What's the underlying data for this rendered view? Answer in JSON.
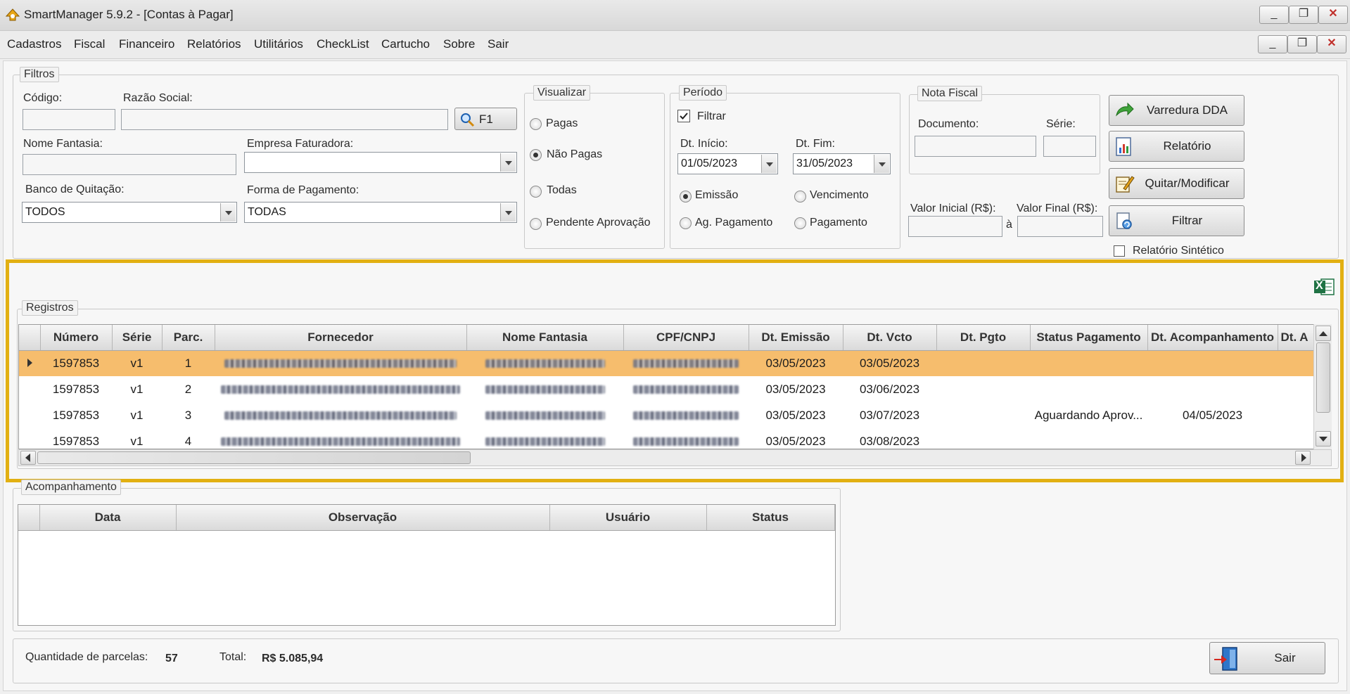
{
  "window": {
    "title": "SmartManager 5.9.2 - [Contas à Pagar]",
    "min_symbol": "_",
    "max_symbol": "❐",
    "close_symbol": "✕"
  },
  "menu": [
    "Cadastros",
    "Fiscal",
    "Financeiro",
    "Relatórios",
    "Utilitários",
    "CheckList",
    "Cartucho",
    "Sobre",
    "Sair"
  ],
  "filtros": {
    "legend": "Filtros",
    "codigo_label": "Código:",
    "codigo_value": "",
    "razao_label": "Razão Social:",
    "razao_value": "",
    "f1_label": "F1",
    "nome_fantasia_label": "Nome Fantasia:",
    "nome_fantasia_value": "",
    "empresa_label": "Empresa Faturadora:",
    "empresa_value": "",
    "banco_label": "Banco de Quitação:",
    "banco_value": "TODOS",
    "forma_label": "Forma de Pagamento:",
    "forma_value": "TODAS"
  },
  "visualizar": {
    "legend": "Visualizar",
    "options": [
      "Pagas",
      "Não Pagas",
      "Todas",
      "Pendente Aprovação"
    ],
    "selected": "Não Pagas"
  },
  "periodo": {
    "legend": "Período",
    "filtrar_label": "Filtrar",
    "filtrar_checked": true,
    "inicio_label": "Dt. Início:",
    "inicio_value": "01/05/2023",
    "fim_label": "Dt. Fim:",
    "fim_value": "31/05/2023",
    "options": [
      "Emissão",
      "Vencimento",
      "Ag. Pagamento",
      "Pagamento"
    ],
    "selected": "Emissão"
  },
  "nota_fiscal": {
    "legend": "Nota Fiscal",
    "documento_label": "Documento:",
    "serie_label": "Série:",
    "documento_value": "",
    "serie_value": ""
  },
  "valores": {
    "inicial_label": "Valor Inicial (R$):",
    "final_label": "Valor Final (R$):",
    "separator": "à",
    "inicial_value": "",
    "final_value": ""
  },
  "actions": {
    "varredura": "Varredura DDA",
    "relatorio": "Relatório",
    "quitar": "Quitar/Modificar",
    "filtrar": "Filtrar",
    "sintetico_label": "Relatório Sintético",
    "sintetico_checked": false
  },
  "registros": {
    "legend": "Registros",
    "excel_glyph": "X",
    "columns": [
      "Número",
      "Série",
      "Parc.",
      "Fornecedor",
      "Nome Fantasia",
      "CPF/CNPJ",
      "Dt. Emissão",
      "Dt. Vcto",
      "Dt. Pgto",
      "Status Pagamento",
      "Dt. Acompanhamento",
      "Dt. A"
    ],
    "rows": [
      {
        "numero": "1597853",
        "serie": "v1",
        "parc": "1",
        "emissao": "03/05/2023",
        "vcto": "03/05/2023",
        "pgto": "",
        "status": "",
        "acomp": "",
        "selected": true
      },
      {
        "numero": "1597853",
        "serie": "v1",
        "parc": "2",
        "emissao": "03/05/2023",
        "vcto": "03/06/2023",
        "pgto": "",
        "status": "",
        "acomp": "",
        "selected": false
      },
      {
        "numero": "1597853",
        "serie": "v1",
        "parc": "3",
        "emissao": "03/05/2023",
        "vcto": "03/07/2023",
        "pgto": "",
        "status": "Aguardando  Aprov...",
        "acomp": "04/05/2023",
        "selected": false
      },
      {
        "numero": "1597853",
        "serie": "v1",
        "parc": "4",
        "emissao": "03/05/2023",
        "vcto": "03/08/2023",
        "pgto": "",
        "status": "",
        "acomp": "",
        "selected": false
      }
    ]
  },
  "acompanhamento": {
    "legend": "Acompanhamento",
    "columns": [
      "Data",
      "Observação",
      "Usuário",
      "Status"
    ]
  },
  "footer": {
    "qtd_label": "Quantidade de parcelas:",
    "qtd_value": "57",
    "total_label": "Total:",
    "total_value": "R$ 5.085,94",
    "sair": "Sair"
  },
  "colors": {
    "highlight_border": "#e2b012",
    "selected_row": "#f6bd6d",
    "excel_green": "#1f7244"
  }
}
